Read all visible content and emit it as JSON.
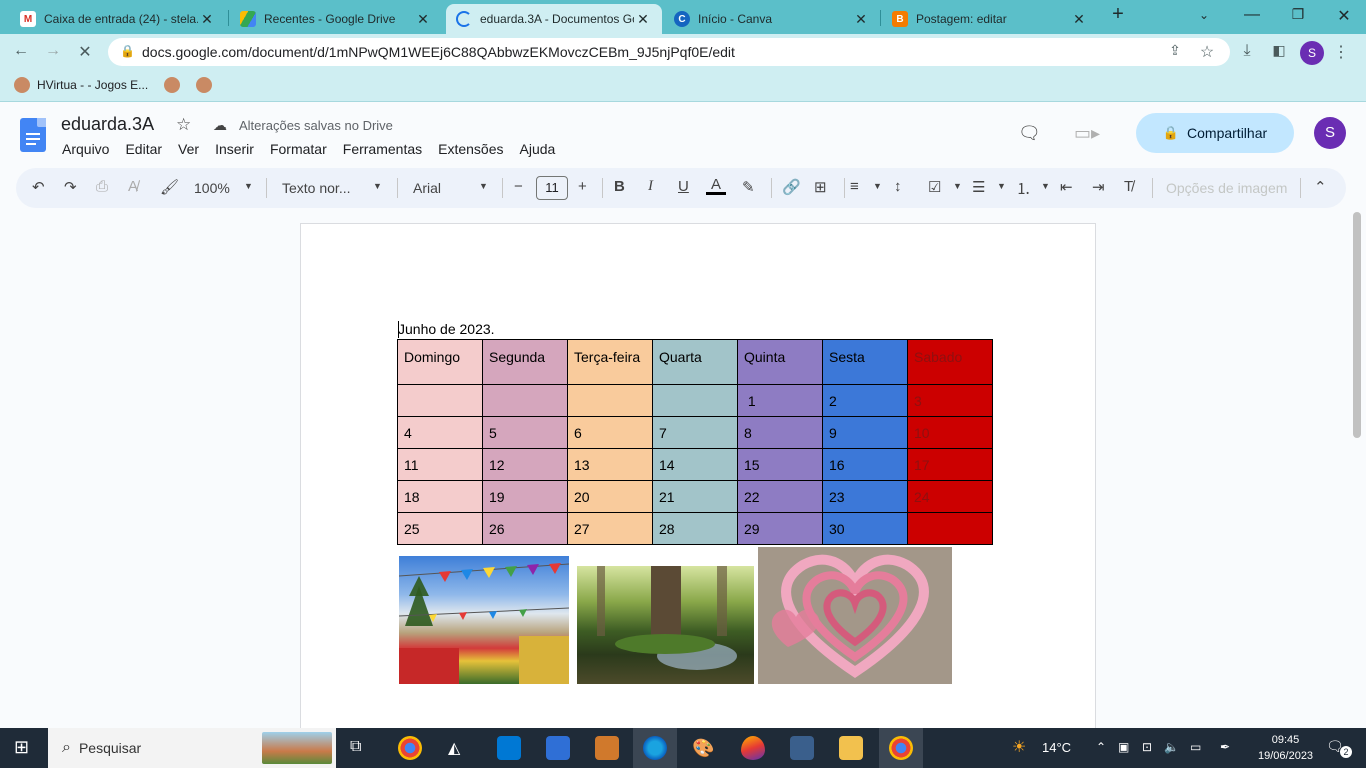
{
  "browser": {
    "tabs": [
      {
        "title": "Caixa de entrada (24) - stela.",
        "favicon": "gmail-icon",
        "color": "#d93025"
      },
      {
        "title": "Recentes - Google Drive",
        "favicon": "drive-icon",
        "color": "#34a853"
      },
      {
        "title": "eduarda.3A - Documentos Go",
        "favicon": "loading-icon",
        "color": "#1a73e8"
      },
      {
        "title": "Início - Canva",
        "favicon": "canva-icon",
        "color": "#00c4cc"
      },
      {
        "title": "Postagem: editar",
        "favicon": "blogger-icon",
        "color": "#f57c00"
      }
    ],
    "url": "docs.google.com/document/d/1mNPwQM1WEEj6C88QAbbwzEKMovczCEBm_9J5njPqf0E/edit",
    "profile_initial": "S",
    "bookmarks": [
      {
        "label": "HVirtua - - Jogos E..."
      },
      {
        "label": ""
      },
      {
        "label": ""
      }
    ]
  },
  "docs": {
    "title": "eduarda.3A",
    "save_status": "Alterações salvas no Drive",
    "menu": [
      "Arquivo",
      "Editar",
      "Ver",
      "Inserir",
      "Formatar",
      "Ferramentas",
      "Extensões",
      "Ajuda"
    ],
    "share_label": "Compartilhar",
    "account_initial": "S",
    "toolbar": {
      "zoom": "100%",
      "style": "Texto nor...",
      "font": "Arial",
      "font_size": "11",
      "image_options": "Opções de imagem"
    }
  },
  "document": {
    "heading": "Junho de 2023.",
    "calendar": {
      "days": [
        "Domingo",
        "Segunda",
        "Terça-feira",
        "Quarta",
        "Quinta",
        "Sesta",
        "Sabado"
      ],
      "weeks": [
        [
          "",
          "",
          "",
          "",
          " 1",
          "2",
          "3"
        ],
        [
          "4",
          "5",
          "6",
          "7",
          "8",
          "9",
          "10"
        ],
        [
          "11",
          "12",
          "13",
          "14",
          "15",
          "16",
          "17"
        ],
        [
          "18",
          "19",
          "20",
          "21",
          "22",
          "23",
          "24"
        ],
        [
          "25",
          "26",
          "27",
          "28",
          "29",
          "30",
          ""
        ]
      ],
      "column_colors": [
        "#f4cccc",
        "#d5a6bd",
        "#f9cb9c",
        "#a2c4c9",
        "#8e7cc3",
        "#3c78d8",
        "#cc0000"
      ]
    },
    "images": [
      "festa-junina-photo",
      "forest-stream-photo",
      "paper-hearts-photo"
    ]
  },
  "taskbar": {
    "search_placeholder": "Pesquisar",
    "weather": "14°C",
    "time": "09:45",
    "date": "19/06/2023",
    "notifications": "2"
  }
}
